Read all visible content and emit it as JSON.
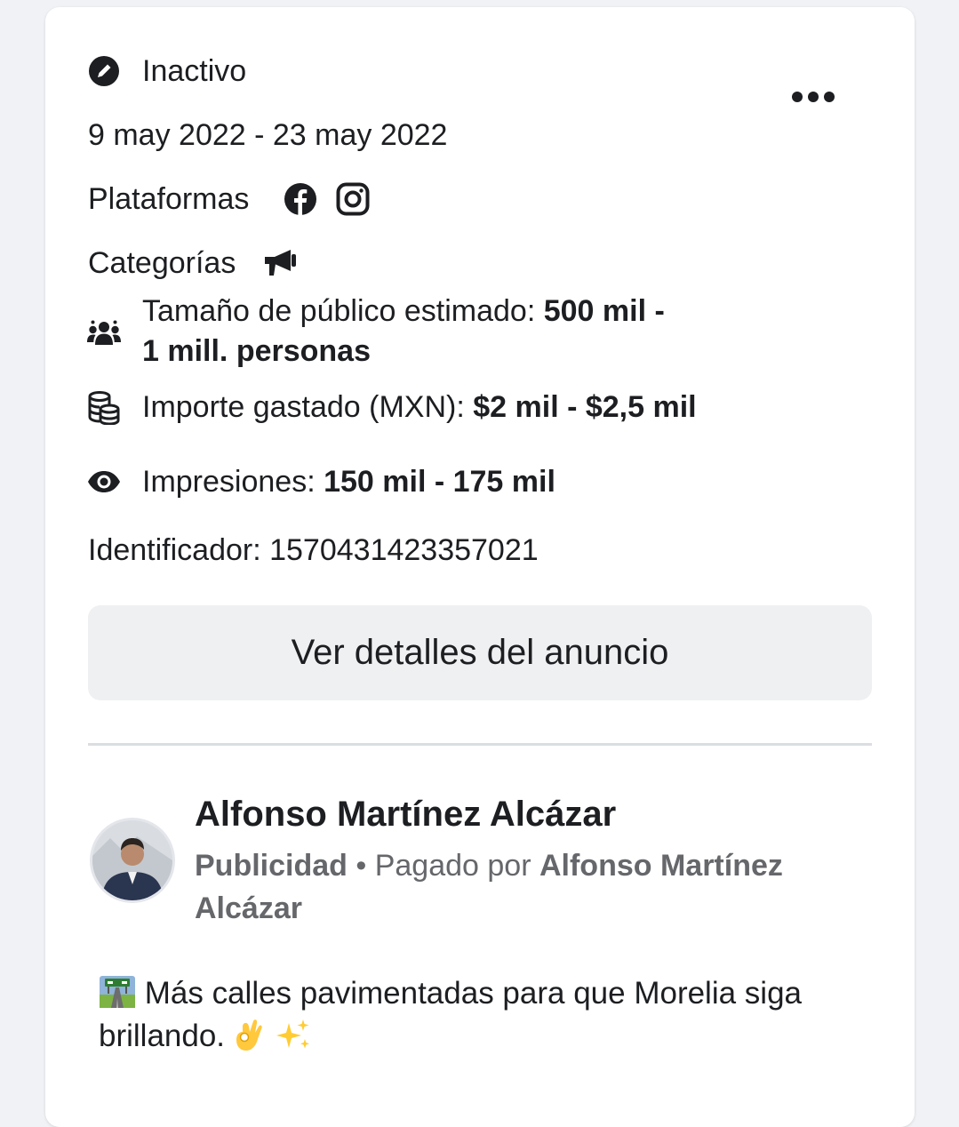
{
  "status": {
    "label": "Inactivo"
  },
  "dates": {
    "range": "9 may 2022 - 23 may 2022"
  },
  "platforms": {
    "label": "Plataformas",
    "icons": [
      "facebook-icon",
      "instagram-icon"
    ]
  },
  "categories": {
    "label": "Categorías",
    "icon": "megaphone-icon"
  },
  "audience": {
    "label": "Tamaño de público estimado: ",
    "value_line1": "500 mil -",
    "value_line2": "1 mill. personas"
  },
  "spend": {
    "label": "Importe gastado (MXN): ",
    "value": "$2 mil - $2,5 mil"
  },
  "impressions": {
    "label": "Impresiones: ",
    "value": "150 mil - 175 mil"
  },
  "identifier": {
    "text": "Identificador: 1570431423357021"
  },
  "details_button": {
    "label": "Ver detalles del anuncio"
  },
  "advertiser": {
    "name": "Alfonso Martínez Alcázar",
    "ad_label": "Publicidad",
    "separator": " • ",
    "paid_by_label": "Pagado por ",
    "paid_by_name": "Alfonso Martínez Alcázar"
  },
  "post": {
    "text": "Más calles pavimentadas para que Morelia siga brillando."
  },
  "colors": {
    "text": "#1c1e21",
    "secondary": "#65676b",
    "button_bg": "#eff0f2",
    "divider": "#dadde1"
  }
}
